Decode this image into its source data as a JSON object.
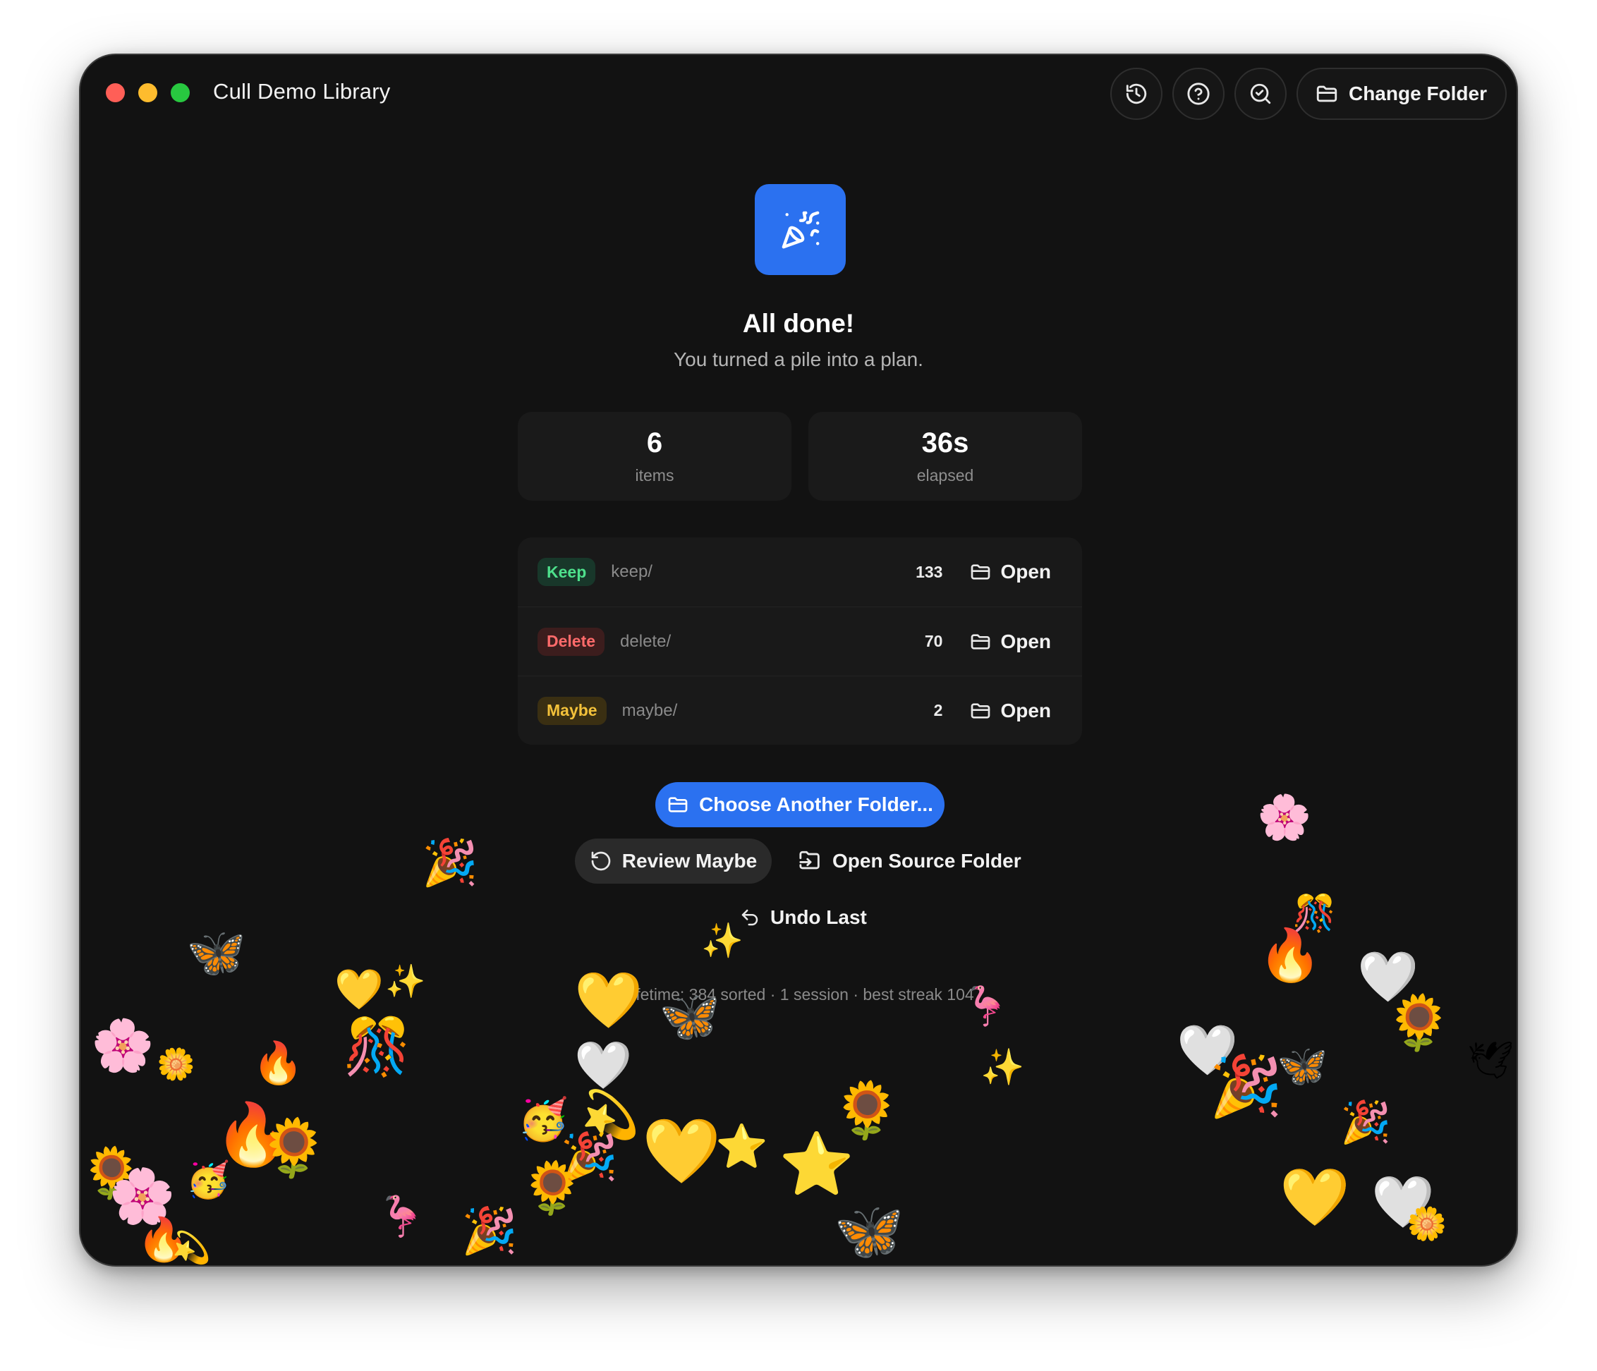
{
  "window": {
    "title": "Cull Demo Library",
    "toolbar": {
      "history_icon": "history-icon",
      "help_icon": "help-icon",
      "inspect_icon": "search-check-icon",
      "change_folder_label": "Change Folder"
    }
  },
  "hero": {
    "icon": "party-popper-icon",
    "title": "All done!",
    "subtitle": "You turned a pile into a plan."
  },
  "stats": [
    {
      "value": "6",
      "label": "items"
    },
    {
      "value": "36s",
      "label": "elapsed"
    }
  ],
  "folders": [
    {
      "badge": "Keep",
      "path": "keep/",
      "count": "133",
      "action": "Open",
      "color": "#4ee08c"
    },
    {
      "badge": "Delete",
      "path": "delete/",
      "count": "70",
      "action": "Open",
      "color": "#ff6b6b"
    },
    {
      "badge": "Maybe",
      "path": "maybe/",
      "count": "2",
      "action": "Open",
      "color": "#f3c13a"
    }
  ],
  "actions": {
    "choose_folder": "Choose Another Folder...",
    "review_maybe": "Review Maybe",
    "open_source": "Open Source Folder",
    "undo_last": "Undo Last"
  },
  "footer": {
    "lifetime": "Lifetime: 384 sorted · 1 session · best streak 104"
  },
  "colors": {
    "accent": "#2b71f0",
    "background": "#121212",
    "card": "#1a1a1a"
  }
}
